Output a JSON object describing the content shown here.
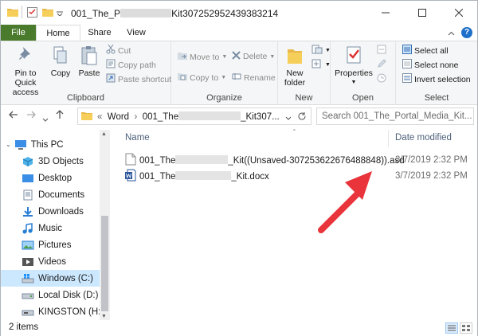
{
  "window": {
    "title_prefix": "001_The_P",
    "title_suffix": "Kit307252952439383214"
  },
  "ribbon": {
    "tabs": [
      "File",
      "Home",
      "Share",
      "View"
    ],
    "help": "?",
    "clipboard": {
      "pin_label": "Pin to Quick access",
      "copy_label": "Copy",
      "paste_label": "Paste",
      "cut_label": "Cut",
      "copy_path_label": "Copy path",
      "paste_shortcut_label": "Paste shortcut",
      "group_label": "Clipboard"
    },
    "organize": {
      "move_to_label": "Move to",
      "copy_to_label": "Copy to",
      "delete_label": "Delete",
      "rename_label": "Rename",
      "group_label": "Organize"
    },
    "new": {
      "new_folder_label": "New folder",
      "group_label": "New"
    },
    "open": {
      "properties_label": "Properties",
      "group_label": "Open"
    },
    "select": {
      "select_all_label": "Select all",
      "select_none_label": "Select none",
      "invert_label": "Invert selection",
      "group_label": "Select"
    }
  },
  "address": {
    "sep": "«",
    "path_part1": "Word",
    "path_part2_prefix": "001_The",
    "path_part2_suffix": "_Kit307...",
    "search_placeholder": "Search 001_The_Portal_Media_Kit..."
  },
  "nav": {
    "items": [
      {
        "label": "This PC",
        "icon": "this-pc-icon"
      },
      {
        "label": "3D Objects",
        "icon": "3d-objects-icon"
      },
      {
        "label": "Desktop",
        "icon": "desktop-icon"
      },
      {
        "label": "Documents",
        "icon": "documents-icon"
      },
      {
        "label": "Downloads",
        "icon": "downloads-icon"
      },
      {
        "label": "Music",
        "icon": "music-icon"
      },
      {
        "label": "Pictures",
        "icon": "pictures-icon"
      },
      {
        "label": "Videos",
        "icon": "videos-icon"
      },
      {
        "label": "Windows (C:)",
        "icon": "drive-c-icon"
      },
      {
        "label": "Local Disk (D:)",
        "icon": "drive-d-icon"
      },
      {
        "label": "KINGSTON (H:)",
        "icon": "usb-drive-icon"
      }
    ]
  },
  "list": {
    "col_name": "Name",
    "col_date": "Date modified",
    "files": [
      {
        "name_prefix": "001_The",
        "name_suffix": "_Kit((Unsaved-307253622676488848)).asd",
        "date": "3/7/2019 2:32 PM"
      },
      {
        "name_prefix": "001_The",
        "name_suffix": "_Kit.docx",
        "date": "3/7/2019 2:32 PM"
      }
    ]
  },
  "status": {
    "count_text": "2 items"
  },
  "colors": {
    "file_tab": "#4a7a2c",
    "accent_blue": "#1e6fc9",
    "annotation_arrow": "#e8343a",
    "selected_nav": "#cce8ff"
  }
}
